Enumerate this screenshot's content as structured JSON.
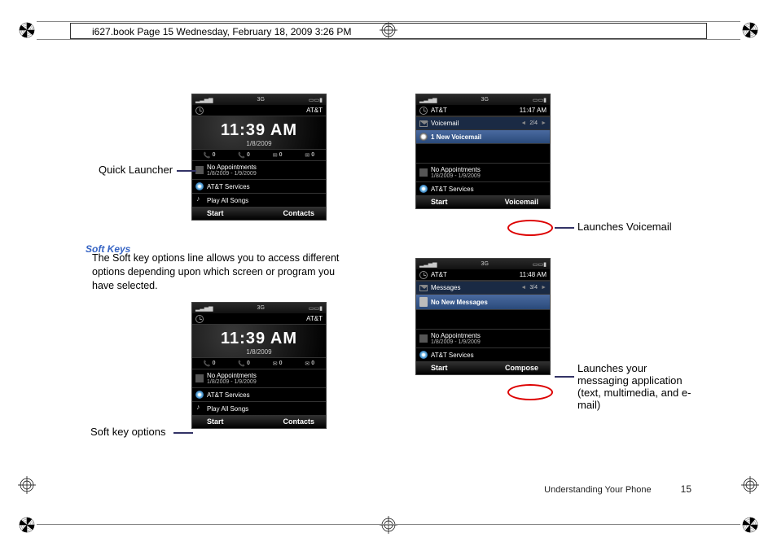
{
  "header": "i627.book  Page 15  Wednesday, February 18, 2009  3:26 PM",
  "section_title": "Soft Keys",
  "body_text": "The Soft key options line allows you to access different options depending upon which screen or program you have selected.",
  "callouts": {
    "quick_launcher": "Quick Launcher",
    "softkey_options": "Soft key options",
    "voicemail": "Launches Voicemail",
    "messaging": "Launches your messaging application (text, multimedia, and  e-mail)"
  },
  "footer": {
    "section": "Understanding Your Phone",
    "page": "15"
  },
  "phone_common": {
    "statusbar_3g": "3G",
    "carrier": "AT&T",
    "appointments": "No Appointments",
    "appt_dates": "1/8/2009 - 1/9/2009",
    "att_services": "AT&T Services",
    "play_all": "Play All Songs",
    "start": "Start"
  },
  "phone1": {
    "time": "11:39 AM",
    "date": "1/8/2009",
    "m0": "0",
    "m1": "0",
    "m2": "0",
    "m3": "0",
    "right_soft": "Contacts"
  },
  "phone2": {
    "time": "11:39 AM",
    "date": "1/8/2009",
    "m0": "0",
    "m1": "0",
    "m2": "0",
    "m3": "0",
    "right_soft": "Contacts"
  },
  "phone3": {
    "time_small": "11:47 AM",
    "voicemail_label": "Voicemail",
    "voicemail_count": "2/4",
    "voicemail_item": "1 New Voicemail",
    "right_soft": "Voicemail"
  },
  "phone4": {
    "time_small": "11:48 AM",
    "messages_label": "Messages",
    "messages_count": "3/4",
    "messages_item": "No New Messages",
    "right_soft": "Compose"
  }
}
